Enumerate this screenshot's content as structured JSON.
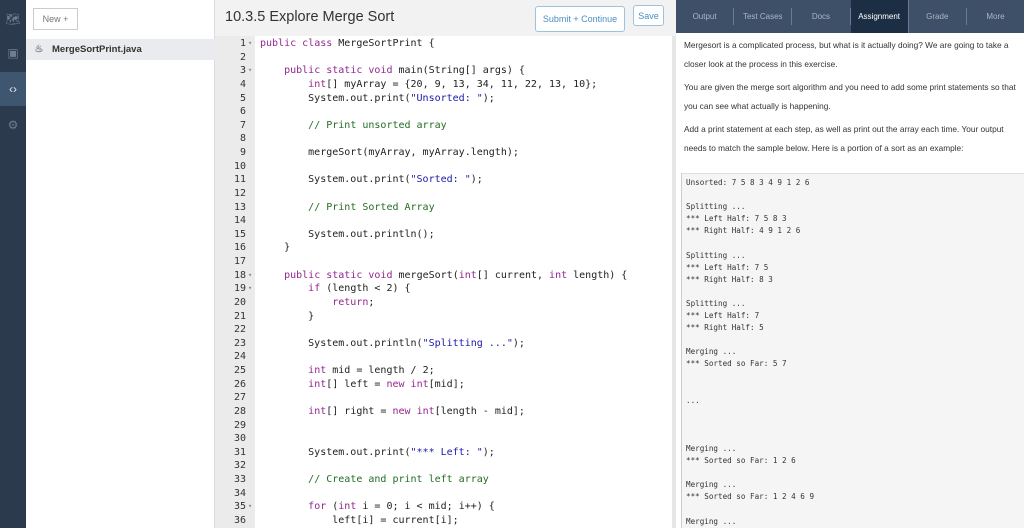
{
  "rail": {
    "icons": [
      "map-icon",
      "calendar-icon",
      "code-file-icon",
      "gear-icon"
    ]
  },
  "files": {
    "new_label": "New +",
    "items": [
      {
        "name": "MergeSortPrint.java"
      }
    ]
  },
  "editor": {
    "title": "10.3.5 Explore Merge Sort",
    "submit_label": "Submit + Continue",
    "save_label": "Save",
    "lines": [
      "public class MergeSortPrint {",
      "",
      "    public static void main(String[] args) {",
      "        int[] myArray = {20, 9, 13, 34, 11, 22, 13, 10};",
      "        System.out.print(\"Unsorted: \");",
      "",
      "        // Print unsorted array",
      "",
      "        mergeSort(myArray, myArray.length);",
      "",
      "        System.out.print(\"Sorted: \");",
      "",
      "        // Print Sorted Array",
      "",
      "        System.out.println();",
      "    }",
      "",
      "    public static void mergeSort(int[] current, int length) {",
      "        if (length < 2) {",
      "            return;",
      "        }",
      "",
      "        System.out.println(\"Splitting ...\");",
      "",
      "        int mid = length / 2;",
      "        int[] left = new int[mid];",
      "",
      "        int[] right = new int[length - mid];",
      "",
      "",
      "        System.out.print(\"*** Left: \");",
      "",
      "        // Create and print left array",
      "",
      "        for (int i = 0; i < mid; i++) {",
      "            left[i] = current[i];"
    ],
    "foldable": [
      1,
      3,
      18,
      19,
      35
    ]
  },
  "right": {
    "tabs": [
      "Output",
      "Test Cases",
      "Docs",
      "Assignment",
      "Grade",
      "More"
    ],
    "active_tab": "Assignment",
    "paragraphs": [
      "Mergesort is a complicated process, but what is it actually doing? We are going to take a closer look at the process in this exercise.",
      "You are given the merge sort algorithm and you need to add some print statements so that you can see what actually is happening.",
      "Add a print statement at each step, as well as print out the array each time. Your output needs to match the sample below. Here is a portion of a sort as an example:"
    ],
    "sample_output": "Unsorted: 7 5 8 3 4 9 1 2 6\n\nSplitting ...\n*** Left Half: 7 5 8 3\n*** Right Half: 4 9 1 2 6\n\nSplitting ...\n*** Left Half: 7 5\n*** Right Half: 8 3\n\nSplitting ...\n*** Left Half: 7\n*** Right Half: 5\n\nMerging ...\n*** Sorted so Far: 5 7\n\n\n...\n\n\n\nMerging ...\n*** Sorted so Far: 1 2 6\n\nMerging ...\n*** Sorted so Far: 1 2 4 6 9\n\nMerging ..."
  }
}
